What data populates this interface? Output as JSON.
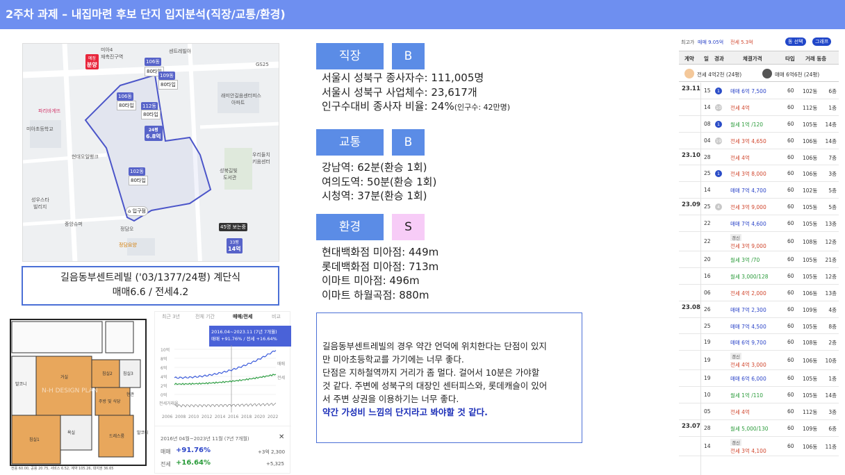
{
  "header": {
    "title": "2주차 과제 – 내집마련 후보 단지 입지분석(직장/교통/환경)"
  },
  "map": {
    "labels": {
      "sale_badge_top": "예정",
      "sale_badge": "분양",
      "school_top": "미아4",
      "school": "재촉진구역",
      "gs": "GS25",
      "seoul_center": "센트레빌아",
      "lemian": "래미안길음센터피스",
      "lemian2": "아파트",
      "paris": "파리바게뜨",
      "mia_elem": "미아초등학교",
      "hyundai": "현대오일뱅크",
      "songbuk_lib": "성북길빛",
      "songbuk_lib2": "도서관",
      "woori": "우리들치",
      "kiumsenter": "키움센터",
      "seongu": "성우스타",
      "seongu2": "빌리지",
      "jungang": "중앙슈퍼",
      "jeongdeung": "정담오",
      "jeongdeung_sub": "정담요양",
      "entrance": "입구점",
      "road_badge": "45명 보는중",
      "price_badge_top": "33평",
      "price_badge": "14억"
    },
    "buildings": [
      {
        "no": "106동",
        "type": "80타입"
      },
      {
        "no": "109동",
        "type": "80타입"
      },
      {
        "no": "106동",
        "type": "80타입"
      },
      {
        "no": "112동",
        "type": "80타입"
      },
      {
        "no": "24평",
        "type": "6.8억"
      },
      {
        "no": "102동",
        "type": "80타입"
      }
    ]
  },
  "caption": {
    "line1": "길음동부센트레빌 ('03/1377/24평) 계단식",
    "line2": "매매6.6 / 전세4.2"
  },
  "mini_chart": {
    "tabs": [
      "최근 3년",
      "전체 기간",
      "매매/전세",
      "비교"
    ],
    "tooltip_line1": "2016.04~2023.11 (7년 7개월)",
    "tooltip_line2": "매매 +91.76% / 전세 +16.64%",
    "y_ticks": [
      "10억",
      "8억",
      "6억",
      "4억",
      "2억",
      "0억"
    ],
    "x_ticks": [
      "2006",
      "2008",
      "2010",
      "2012",
      "2014",
      "2016",
      "2018",
      "2020",
      "2022"
    ],
    "legend_sale": "매매",
    "legend_jeonse": "전세",
    "legend_volume": "전세거래율",
    "summary_period": "2016년 04월~2023년 11월 (7년 7개월)",
    "sale_label": "매매",
    "sale_pct": "+91.76%",
    "sale_amt": "+3억 2,300",
    "jeonse_label": "전세",
    "jeonse_pct": "+16.64%",
    "jeonse_amt": "+5,325",
    "close": "✕",
    "colors": {
      "sale": "#3b5bdb",
      "jeonse": "#2f9e44"
    }
  },
  "sections": {
    "work": {
      "label": "직장",
      "grade": "B",
      "lines": [
        "서울시 성북구 종사자수: 111,005명",
        "서울시 성북구 사업체수: 23,617개",
        "인구수대비 종사자 비율: 24%"
      ],
      "note": "(인구수: 42만명)"
    },
    "traffic": {
      "label": "교통",
      "grade": "B",
      "lines": [
        "강남역: 62분(환승 1회)",
        "여의도역: 50분(환승 1회)",
        "시청역: 37분(환승 1회)"
      ]
    },
    "env": {
      "label": "환경",
      "grade": "S",
      "lines": [
        "현대백화점 미아점: 449m",
        "롯데백화점 미아점: 713m",
        "이마트 미아점: 496m",
        "이마트 하월곡점: 880m"
      ]
    }
  },
  "comment": {
    "lines": [
      "길음동부센트레빌의 경우 약간 언덕에 위치한다는 단점이 있지",
      "만 미아초등학교를 가기에는 너무 좋다.",
      "단점은 지하철역까지 거리가 좀 멀다. 걸어서 10분은 가야할",
      "것 같다. 주변에 성북구의 대장인 센터피스와, 롯데캐슬이 있어",
      "서 주변 상권을 이용하기는 너무 좋다."
    ],
    "emphasis": "약간 가성비 느낌의 단지라고 봐야할 것 같다."
  },
  "trade": {
    "top_label": "최고가",
    "top_sale": "매매 9.05억",
    "top_jeonse": "전세 5.3억",
    "btn_dong": "동 선택",
    "btn_graph": "그래프",
    "columns": [
      "계약",
      "일",
      "경과",
      "체결가격",
      "타입",
      "거래 동층"
    ],
    "current_jeonse": "전세 4억2천 (24평)",
    "current_sale": "매매 6억6천 (24평)",
    "renew_label": "갱신",
    "rows": [
      {
        "month": "23.11",
        "day": "15",
        "badge": "1",
        "badge_gray": false,
        "kind": "sale",
        "renew": false,
        "price": "매매 6억 7,500",
        "type": "60",
        "dong": "102동",
        "floor": "6층"
      },
      {
        "month": "",
        "day": "14",
        "badge": "10",
        "badge_gray": true,
        "kind": "jeon",
        "renew": false,
        "price": "전세 4억",
        "type": "60",
        "dong": "112동",
        "floor": "1층"
      },
      {
        "month": "",
        "day": "08",
        "badge": "1",
        "badge_gray": false,
        "kind": "wol",
        "renew": false,
        "price": "월세 1억 /120",
        "type": "60",
        "dong": "105동",
        "floor": "14층"
      },
      {
        "month": "",
        "day": "04",
        "badge": "19",
        "badge_gray": true,
        "kind": "jeon",
        "renew": false,
        "price": "전세 3억 4,650",
        "type": "60",
        "dong": "106동",
        "floor": "14층"
      },
      {
        "month": "23.10",
        "day": "28",
        "badge": "",
        "badge_gray": false,
        "kind": "jeon",
        "renew": false,
        "price": "전세 4억",
        "type": "60",
        "dong": "106동",
        "floor": "7층"
      },
      {
        "month": "",
        "day": "25",
        "badge": "1",
        "badge_gray": false,
        "kind": "jeon",
        "renew": false,
        "price": "전세 3억 8,000",
        "type": "60",
        "dong": "106동",
        "floor": "3층"
      },
      {
        "month": "",
        "day": "14",
        "badge": "",
        "badge_gray": false,
        "kind": "sale",
        "renew": false,
        "price": "매매 7억 4,700",
        "type": "60",
        "dong": "102동",
        "floor": "5층"
      },
      {
        "month": "23.09",
        "day": "25",
        "badge": "4",
        "badge_gray": true,
        "kind": "jeon",
        "renew": false,
        "price": "전세 3억 9,000",
        "type": "60",
        "dong": "105동",
        "floor": "5층"
      },
      {
        "month": "",
        "day": "22",
        "badge": "",
        "badge_gray": false,
        "kind": "sale",
        "renew": false,
        "price": "매매 7억 4,600",
        "type": "60",
        "dong": "105동",
        "floor": "13층"
      },
      {
        "month": "",
        "day": "22",
        "badge": "",
        "badge_gray": false,
        "kind": "jeon",
        "renew": true,
        "price": "전세 3억 9,000",
        "type": "60",
        "dong": "108동",
        "floor": "12층"
      },
      {
        "month": "",
        "day": "20",
        "badge": "",
        "badge_gray": false,
        "kind": "wol",
        "renew": false,
        "price": "월세 3억 /70",
        "type": "60",
        "dong": "105동",
        "floor": "21층"
      },
      {
        "month": "",
        "day": "16",
        "badge": "",
        "badge_gray": false,
        "kind": "wol",
        "renew": false,
        "price": "월세 3,000/128",
        "type": "60",
        "dong": "105동",
        "floor": "12층"
      },
      {
        "month": "",
        "day": "06",
        "badge": "",
        "badge_gray": false,
        "kind": "jeon",
        "renew": false,
        "price": "전세 4억 2,000",
        "type": "60",
        "dong": "106동",
        "floor": "13층"
      },
      {
        "month": "23.08",
        "day": "26",
        "badge": "",
        "badge_gray": false,
        "kind": "sale",
        "renew": false,
        "price": "매매 7억 2,300",
        "type": "60",
        "dong": "109동",
        "floor": "4층"
      },
      {
        "month": "",
        "day": "25",
        "badge": "",
        "badge_gray": false,
        "kind": "sale",
        "renew": false,
        "price": "매매 7억 4,500",
        "type": "60",
        "dong": "105동",
        "floor": "8층"
      },
      {
        "month": "",
        "day": "19",
        "badge": "",
        "badge_gray": false,
        "kind": "sale",
        "renew": false,
        "price": "매매 6억 9,700",
        "type": "60",
        "dong": "108동",
        "floor": "2층"
      },
      {
        "month": "",
        "day": "19",
        "badge": "",
        "badge_gray": false,
        "kind": "jeon",
        "renew": true,
        "price": "전세 4억 3,000",
        "type": "60",
        "dong": "106동",
        "floor": "10층"
      },
      {
        "month": "",
        "day": "19",
        "badge": "",
        "badge_gray": false,
        "kind": "sale",
        "renew": false,
        "price": "매매 6억 6,000",
        "type": "60",
        "dong": "105동",
        "floor": "1층"
      },
      {
        "month": "",
        "day": "10",
        "badge": "",
        "badge_gray": false,
        "kind": "wol",
        "renew": false,
        "price": "월세 1억 /110",
        "type": "60",
        "dong": "105동",
        "floor": "14층"
      },
      {
        "month": "",
        "day": "05",
        "badge": "",
        "badge_gray": false,
        "kind": "jeon",
        "renew": false,
        "price": "전세 4억",
        "type": "60",
        "dong": "112동",
        "floor": "3층"
      },
      {
        "month": "23.07",
        "day": "28",
        "badge": "",
        "badge_gray": false,
        "kind": "wol",
        "renew": false,
        "price": "월세 5,000/130",
        "type": "60",
        "dong": "109동",
        "floor": "6층"
      },
      {
        "month": "",
        "day": "14",
        "badge": "",
        "badge_gray": false,
        "kind": "jeon",
        "renew": true,
        "price": "전세 3억 4,100",
        "type": "60",
        "dong": "106동",
        "floor": "11층"
      }
    ]
  },
  "floorplan": {
    "rooms": [
      "발코니",
      "거실",
      "침실2",
      "침실3",
      "주방 및 식당",
      "침실1",
      "욕실",
      "현관",
      "드레스룸",
      "발코니"
    ],
    "watermark": "N-H DESIGN PLAN",
    "footer": "전용 60.00, 공용 20.75, 서비스 6.52, 계약 105.26, 대지권 36.65"
  }
}
